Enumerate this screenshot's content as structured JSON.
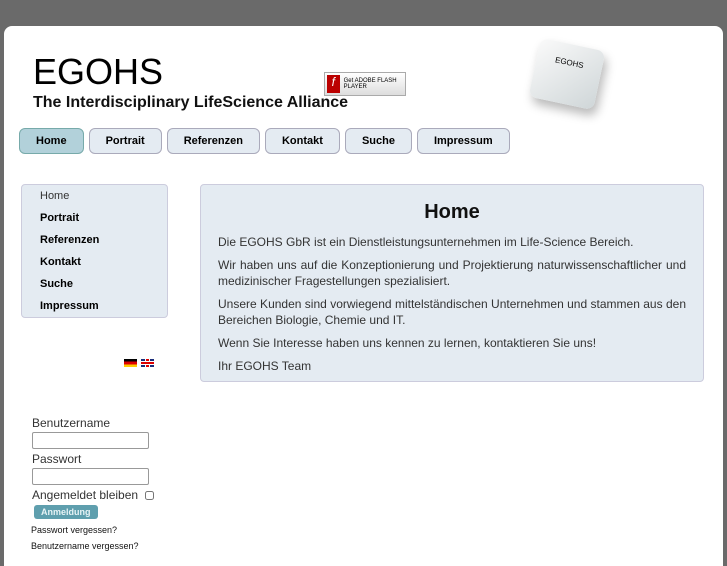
{
  "header": {
    "title": "EGOHS",
    "subtitle": "The Interdisciplinary LifeScience Alliance",
    "flash_badge": "Get ADOBE FLASH PLAYER",
    "key_logo": "EGOHS"
  },
  "nav": [
    "Home",
    "Portrait",
    "Referenzen",
    "Kontakt",
    "Suche",
    "Impressum"
  ],
  "sidebar": [
    "Home",
    "Portrait",
    "Referenzen",
    "Kontakt",
    "Suche",
    "Impressum"
  ],
  "main": {
    "heading": "Home",
    "paragraphs": [
      "Die EGOHS GbR ist ein Dienstleistungsunternehmen im Life-Science Bereich.",
      "Wir haben uns auf die Konzeptionierung und Projektierung naturwissenschaftlicher und medizinischer Fragestellungen spezialisiert.",
      "Unsere Kunden sind vorwiegend mittelständischen Unternehmen und stammen aus den Bereichen Biologie, Chemie und IT.",
      "Wenn Sie Interesse haben uns kennen zu lernen, kontaktieren Sie uns!",
      "Ihr EGOHS Team"
    ]
  },
  "login": {
    "username_label": "Benutzername",
    "password_label": "Passwort",
    "remember_label": "Angemeldet bleiben",
    "submit": "Anmeldung",
    "forgot_password": "Passwort vergessen?",
    "forgot_username": "Benutzername vergessen?"
  }
}
